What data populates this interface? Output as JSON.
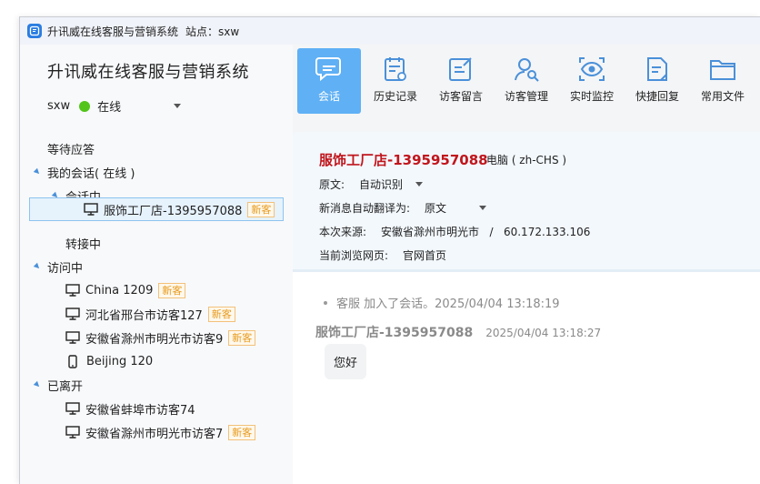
{
  "window": {
    "title": "升讯威在线客服与营销系统",
    "site": "站点：sxw"
  },
  "left": {
    "brand": "升讯威在线客服与营销系统",
    "account": "sxw",
    "status": "在线",
    "status_color": "#52c41a",
    "tree": {
      "waiting": "等待应答",
      "my_sessions": "我的会话( 在线 )",
      "in_session": "会话中",
      "session_visitor": "服饰工厂店-1395957088",
      "transferring": "转接中",
      "visiting": "访问中",
      "visitors": [
        {
          "name": "China 1209",
          "badge": "新客",
          "device": "monitor-icon"
        },
        {
          "name": "河北省邢台市访客127",
          "badge": "新客",
          "device": "monitor-icon"
        },
        {
          "name": "安徽省滁州市明光市访客9",
          "badge": "新客",
          "device": "monitor-icon"
        },
        {
          "name": "Beijing 120",
          "badge": "",
          "device": "phone-icon"
        }
      ],
      "left_group": "已离开",
      "left_visitors": [
        {
          "name": "安徽省蚌埠市访客74",
          "badge": "",
          "device": "monitor-icon"
        },
        {
          "name": "安徽省滁州市明光市访客7",
          "badge": "新客",
          "device": "monitor-icon"
        }
      ],
      "new_badge": "新客"
    }
  },
  "toolbar": {
    "accent": "#5fb0f5",
    "items": [
      {
        "label": "会话",
        "icon": "chat-icon"
      },
      {
        "label": "历史记录",
        "icon": "history-icon"
      },
      {
        "label": "访客留言",
        "icon": "message-edit-icon"
      },
      {
        "label": "访客管理",
        "icon": "visitor-search-icon"
      },
      {
        "label": "实时监控",
        "icon": "eye-icon"
      },
      {
        "label": "快捷回复",
        "icon": "quick-reply-icon"
      },
      {
        "label": "常用文件",
        "icon": "folder-icon"
      }
    ]
  },
  "session": {
    "visitor_name": "服饰工厂店-1395957088",
    "device": "电脑 ( zh-CHS )",
    "original_label": "原文:",
    "original_value": "自动识别",
    "translate_label": "新消息自动翻译为:",
    "translate_value": "原文",
    "source_label": "本次来源:",
    "source_value": "安徽省滁州市明光市   /   60.172.133.106",
    "page_label": "当前浏览网页:",
    "page_value": "官网首页"
  },
  "messages": {
    "system_text": "客服 加入了会话。2025/04/04 13:18:19",
    "sender": "服饰工厂店-1395957088",
    "time": "2025/04/04 13:18:27",
    "text": "您好"
  }
}
